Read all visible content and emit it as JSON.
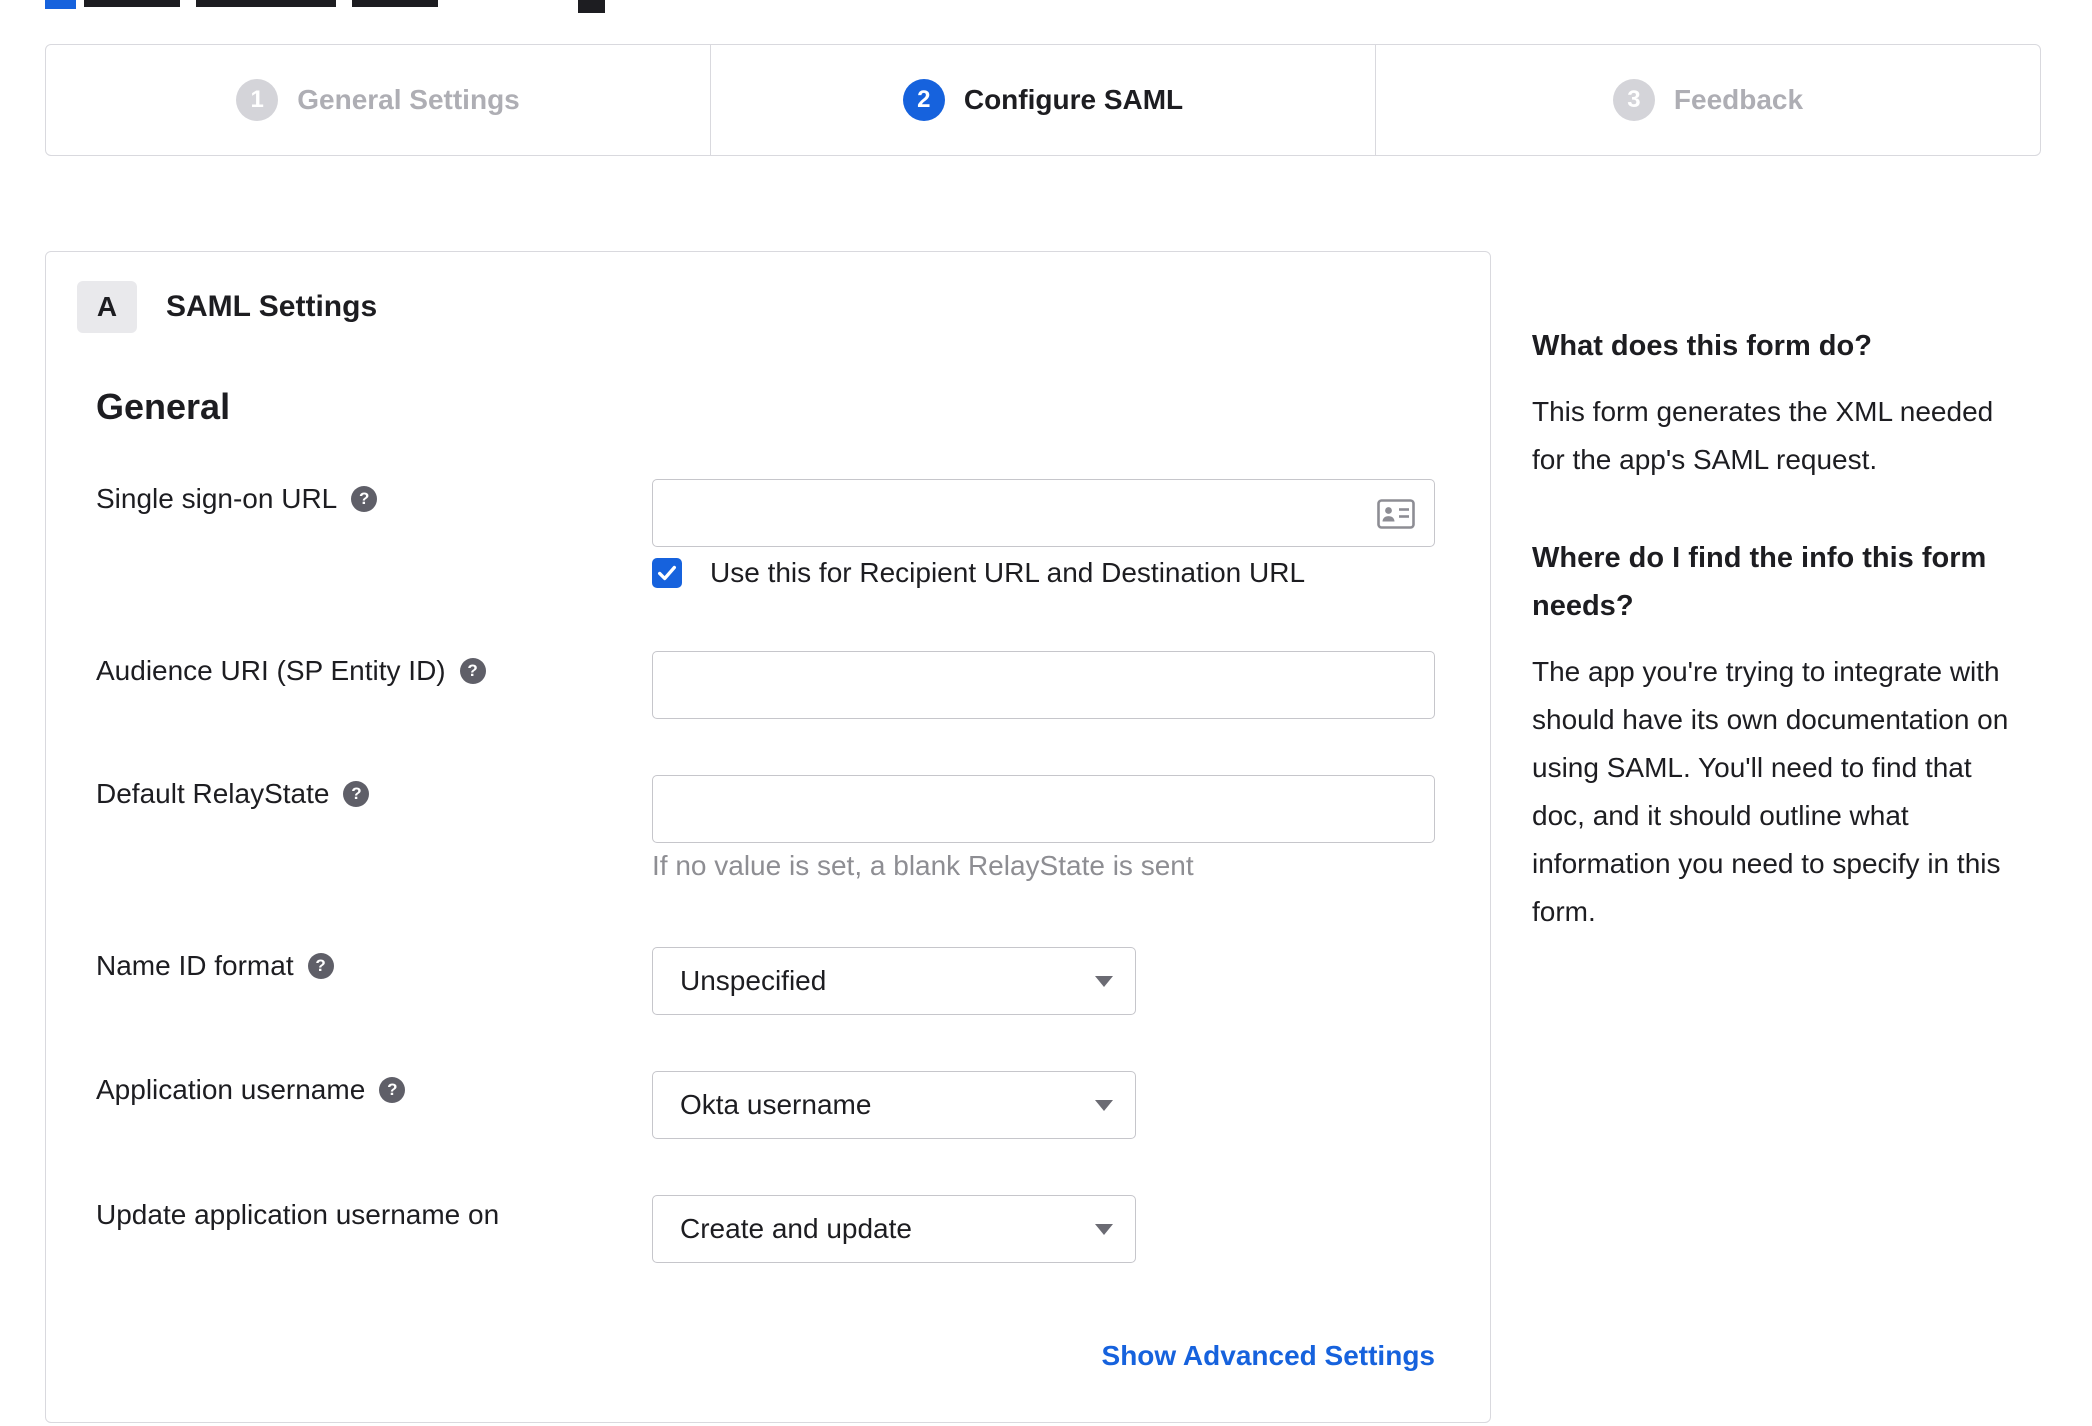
{
  "colors": {
    "accent_blue": "#1662dd",
    "inactive_circle_gray": "#d4d4d9",
    "inactive_label_gray": "#aeaeb4",
    "link_blue": "#1662dd",
    "helper_text_gray": "#8e8e93",
    "border_gray": "#d9d9de"
  },
  "stepper": {
    "steps": [
      {
        "number": "1",
        "label": "General Settings",
        "state": "inactive"
      },
      {
        "number": "2",
        "label": "Configure SAML",
        "state": "active"
      },
      {
        "number": "3",
        "label": "Feedback",
        "state": "inactive"
      }
    ]
  },
  "panel": {
    "badge": "A",
    "title": "SAML Settings",
    "group": "General",
    "fields": {
      "sso": {
        "label": "Single sign-on URL",
        "value": "",
        "checkbox_checked": true,
        "checkbox_label": "Use this for Recipient URL and Destination URL"
      },
      "audience": {
        "label": "Audience URI (SP Entity ID)",
        "value": ""
      },
      "relay": {
        "label": "Default RelayState",
        "value": "",
        "helper": "If no value is set, a blank RelayState is sent"
      },
      "name_id": {
        "label": "Name ID format",
        "value": "Unspecified"
      },
      "app_username": {
        "label": "Application username",
        "value": "Okta username"
      },
      "update_on": {
        "label": "Update application username on",
        "value": "Create and update"
      }
    },
    "advanced_link": "Show Advanced Settings"
  },
  "icons": {
    "help_glyph": "?",
    "sso_input_icon": "contact-card"
  },
  "sidebar": {
    "blocks": [
      {
        "heading": "What does this form do?",
        "body": "This form generates the XML needed\nfor the app's SAML request."
      },
      {
        "heading": "Where do I find the info this form\nneeds?",
        "body": "The app you're trying to integrate with\nshould have its own documentation on\nusing SAML. You'll need to find that\ndoc, and it should outline what\ninformation you need to specify in this\nform."
      }
    ]
  }
}
